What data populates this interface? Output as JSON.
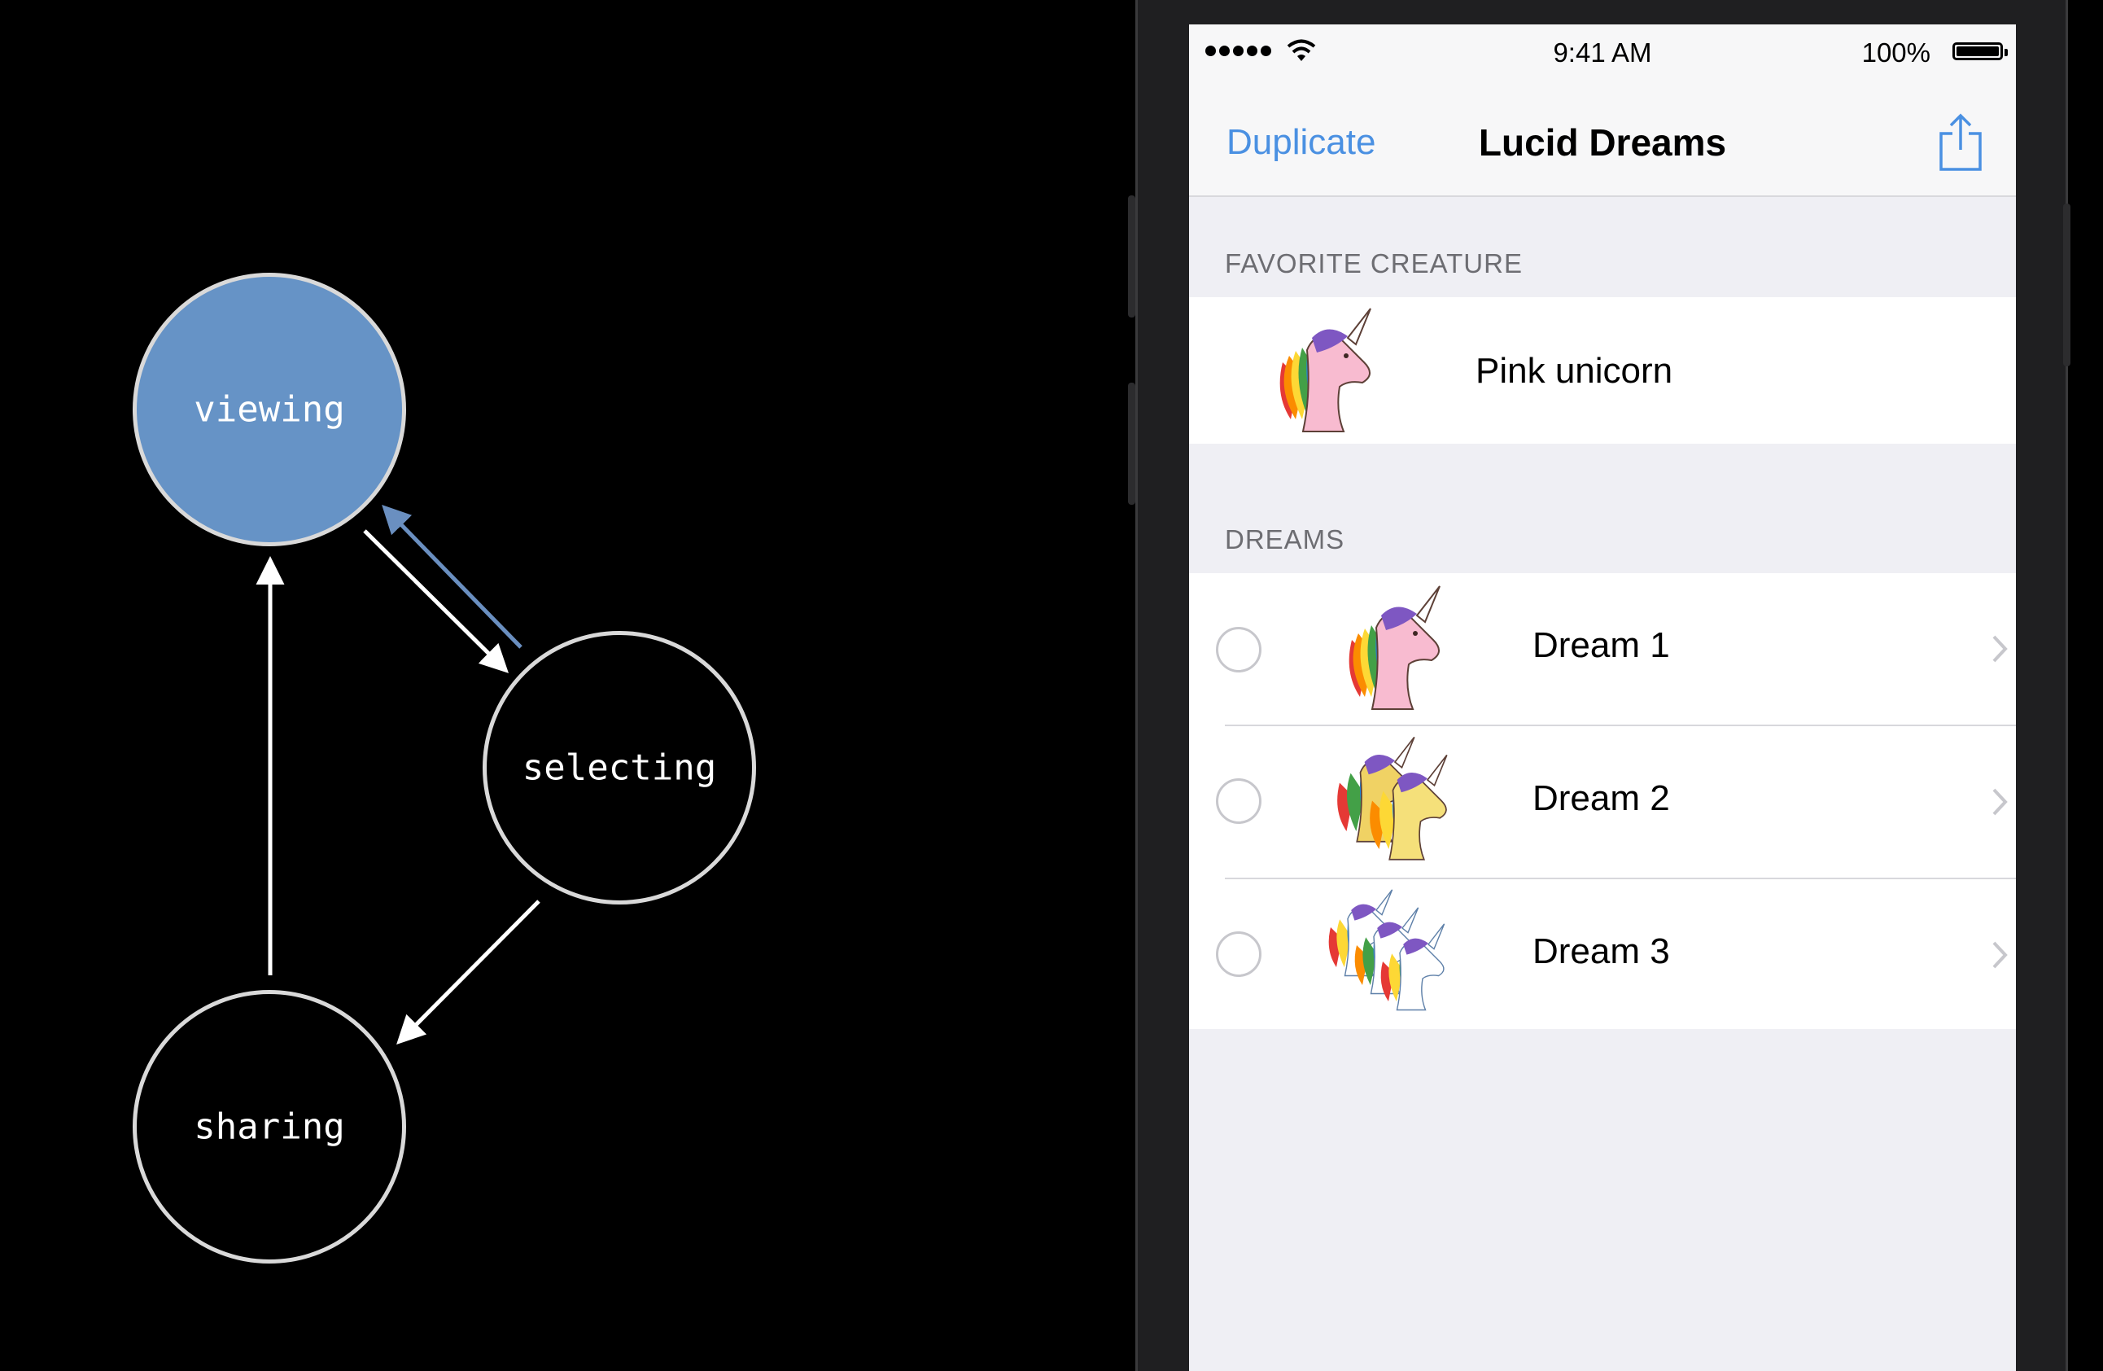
{
  "diagram": {
    "nodes": {
      "viewing": {
        "label": "viewing",
        "fill": "#6693c6"
      },
      "selecting": {
        "label": "selecting"
      },
      "sharing": {
        "label": "sharing"
      }
    },
    "colors": {
      "edge": "#ffffff",
      "highlight_edge": "#6a8fc0",
      "node_stroke": "#d9d9d9"
    }
  },
  "phone": {
    "status_bar": {
      "time": "9:41 AM",
      "battery": "100%"
    },
    "nav": {
      "left_button": "Duplicate",
      "title": "Lucid Dreams",
      "share_icon": "share-icon"
    },
    "sections": {
      "favorite": {
        "header": "FAVORITE CREATURE",
        "label": "Pink unicorn",
        "icon": "pink-unicorn-icon"
      },
      "dreams": {
        "header": "DREAMS",
        "items": [
          {
            "label": "Dream 1",
            "icon": "pink-unicorn-icon"
          },
          {
            "label": "Dream 2",
            "icon": "yellow-unicorns-icon"
          },
          {
            "label": "Dream 3",
            "icon": "white-unicorns-icon"
          }
        ]
      }
    },
    "colors": {
      "accent": "#4a90e2",
      "background": "#efeff4"
    }
  }
}
